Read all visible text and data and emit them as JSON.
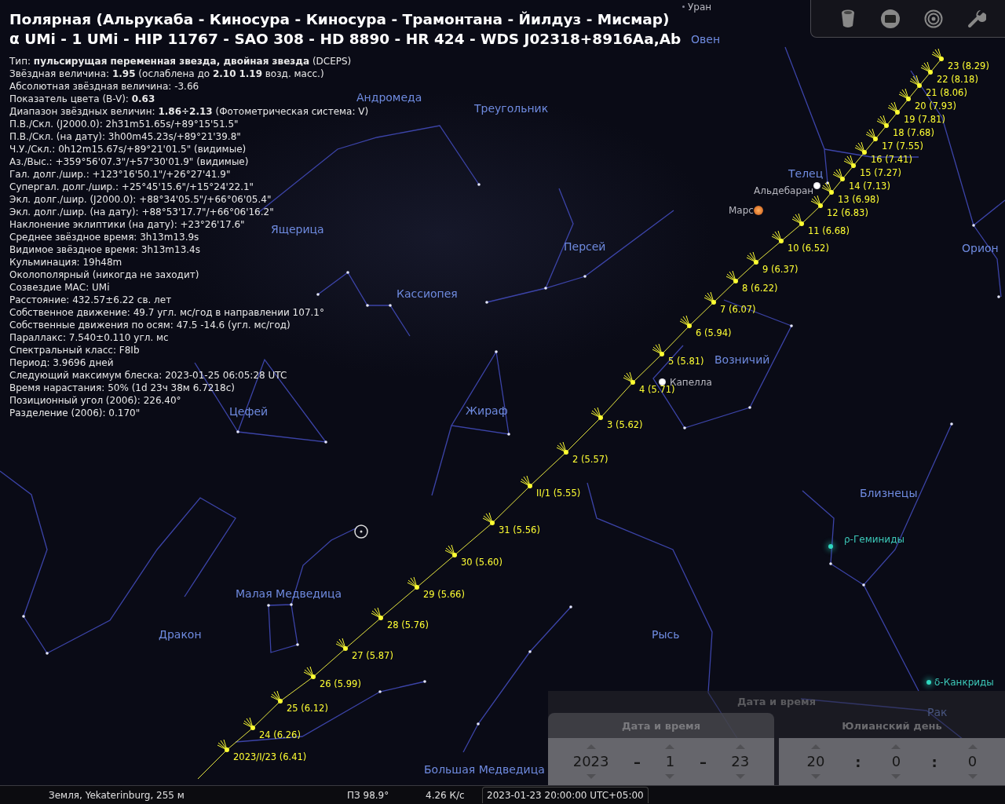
{
  "object_info": {
    "title_lines": [
      "Полярная (Альрукаба - Киносура - Киносура - Трамонтана - Йилдуз - Мисмар)",
      "α UMi - 1 UMi - HIP 11767 - SAO 308 - HD 8890 - HR 424 - WDS J02318+8916Aa,Ab"
    ],
    "lines": [
      "Тип: **пульсирущая переменная звезда, двойная звезда** (DCEPS)",
      "Звёздная величина: **1.95** (ослаблена до **2.10** **1.19** возд. масс.)",
      "Абсолютная звёздная величина: -3.66",
      "Показатель цвета (B-V): **0.63**",
      "Диапазон звёздных величин: **1.86÷2.13** (Фотометрическая система: V)",
      "П.В./Скл. (J2000.0): 2h31m51.65s/+89°15'51.5\"",
      "П.В./Скл. (на дату): 3h00m45.23s/+89°21'39.8\"",
      "Ч.У./Скл.: 0h12m15.67s/+89°21'01.5\" (видимые)",
      "Аз./Выс.: +359°56'07.3\"/+57°30'01.9\" (видимые)",
      "Гал. долг./шир.: +123°16'50.1\"/+26°27'41.9\"",
      "Супергал. долг./шир.: +25°45'15.6\"/+15°24'22.1\"",
      "Экл. долг./шир. (J2000.0): +88°34'05.5\"/+66°06'05.4\"",
      "Экл. долг./шир. (на дату): +88°53'17.7\"/+66°06'16.2\"",
      "Наклонение эклиптики (на дату): +23°26'17.6\"",
      "Среднее звёздное время: 3h13m13.9s",
      "Видимое звёздное время: 3h13m13.4s",
      "Кульминация: 19h48m",
      "Околополярный (никогда не заходит)",
      "Созвездие МАС: UMi",
      "Расстояние: 432.57±6.22 св. лет",
      "Собственное движение: 49.7 угл. мс/год в направлении 107.1°",
      "Собственные движения по осям: 47.5 -14.6 (угл. мс/год)",
      "Параллакс: 7.540±0.110 угл. мс",
      "Спектральный класс: F8Ib",
      "Период: 3.9696 дней",
      "Следующий максимум блеска: 2023-01-25 06:05:28 UTC",
      "Время нарастания: 50% (1d 23ч 38м 6.7218с)",
      "Позиционный угол (2006): 226.40°",
      "Разделение (2006): 0.170\""
    ]
  },
  "sky": {
    "constellations": [
      "Овен",
      "Андромеда",
      "Треугольник",
      "Телец",
      "Ящерица",
      "Персей",
      "Орион",
      "Кассиопея",
      "Возничий",
      "Цефей",
      "Жираф",
      "Близнецы",
      "Малая Медведица",
      "Дракон",
      "Рысь",
      "Рак",
      "Большая Медведица"
    ],
    "objects": [
      {
        "name": "Уран",
        "kind": "faint_planet"
      },
      {
        "name": "Марс",
        "kind": "planet"
      },
      {
        "name": "Альдебаран",
        "kind": "star"
      },
      {
        "name": "Капелла",
        "kind": "star"
      },
      {
        "name": "ρ-Геминиды",
        "kind": "meteor_shower"
      },
      {
        "name": "δ-Канкриды",
        "kind": "meteor_shower"
      }
    ],
    "ephemeris": [
      "23 (8.29)",
      "22 (8.18)",
      "21 (8.06)",
      "20 (7.93)",
      "19 (7.81)",
      "18 (7.68)",
      "17 (7.55)",
      "16 (7.41)",
      "15 (7.27)",
      "14 (7.13)",
      "13 (6.98)",
      "12 (6.83)",
      "11 (6.68)",
      "10 (6.52)",
      "9 (6.37)",
      "8 (6.22)",
      "7 (6.07)",
      "6 (5.94)",
      "5 (5.81)",
      "4 (5.71)",
      "3 (5.62)",
      "2 (5.57)",
      "II/1 (5.55)",
      "31 (5.56)",
      "30 (5.60)",
      "29 (5.66)",
      "28 (5.76)",
      "27 (5.87)",
      "26 (5.99)",
      "25 (6.12)",
      "24 (6.26)",
      "2023/I/23 (6.41)"
    ]
  },
  "date_time_dialog": {
    "title": "Дата и время",
    "tabs": [
      {
        "label": "Дата и время",
        "selected": true
      },
      {
        "label": "Юлианский день",
        "selected": false
      }
    ],
    "date_fields": [
      {
        "kind": "spin",
        "value": "2023"
      },
      {
        "kind": "separator",
        "value": "–"
      },
      {
        "kind": "spin",
        "value": "1"
      },
      {
        "kind": "separator",
        "value": "–"
      },
      {
        "kind": "spin",
        "value": "23"
      }
    ],
    "time_fields": [
      {
        "kind": "spin",
        "value": "20"
      },
      {
        "kind": "separator",
        "value": ":"
      },
      {
        "kind": "spin",
        "value": "0"
      },
      {
        "kind": "separator",
        "value": ":"
      },
      {
        "kind": "spin",
        "value": "0"
      }
    ]
  },
  "status_bar": {
    "location": "Земля, Yekaterinburg, 255 м",
    "fov": "ПЗ 98.9°",
    "fps": "4.26 К/с",
    "datetime": "2023-01-23 20:00:00 UTC+05:00"
  }
}
